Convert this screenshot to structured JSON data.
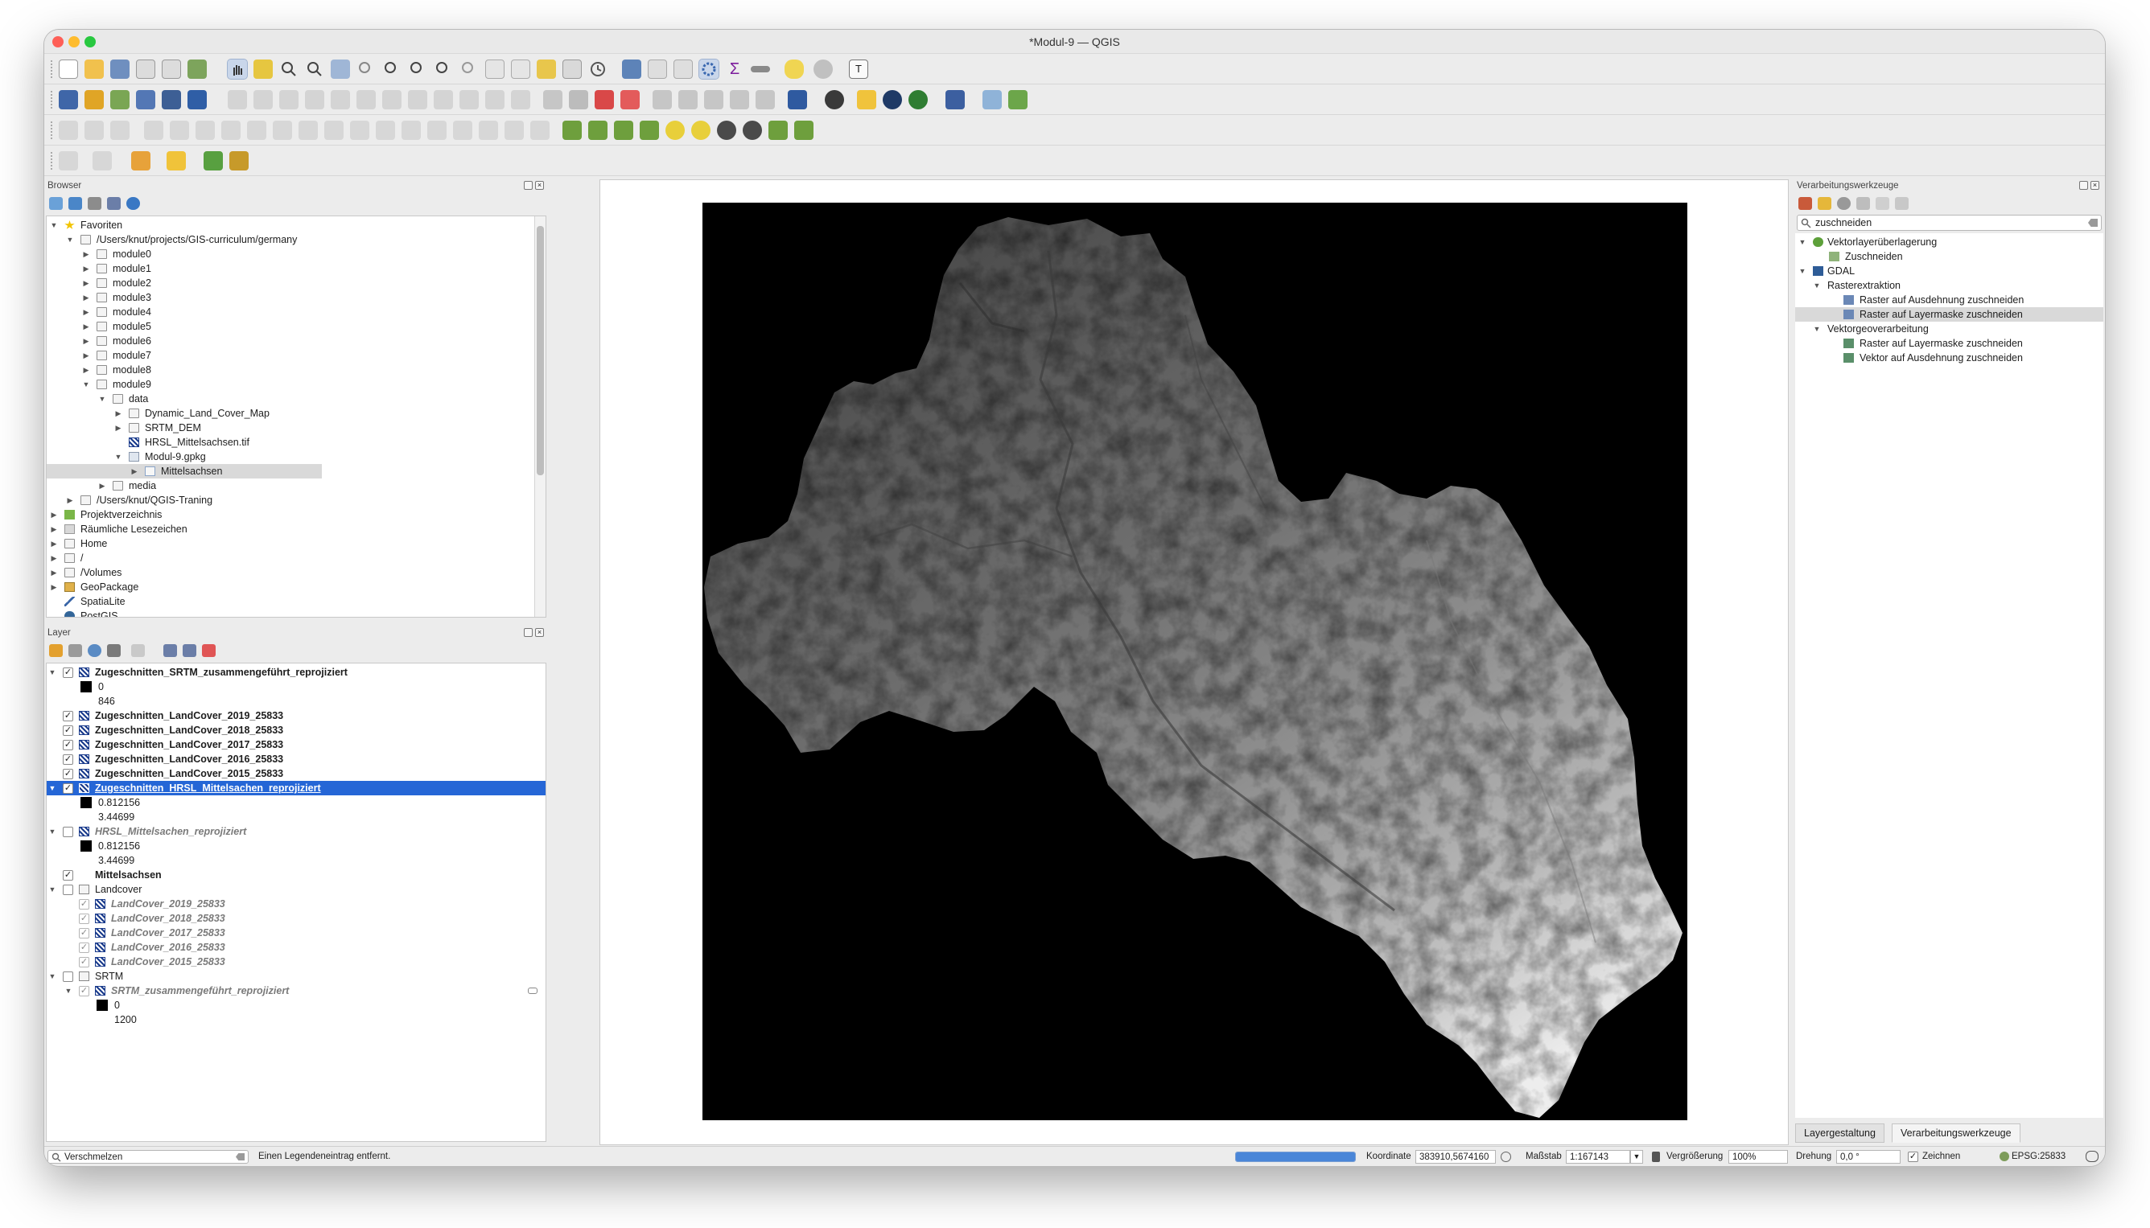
{
  "window": {
    "title": "*Modul-9 — QGIS"
  },
  "browser": {
    "title": "Browser",
    "items": [
      {
        "label": "Favoriten"
      },
      {
        "label": "/Users/knut/projects/GIS-curriculum/germany"
      },
      {
        "label": "module0"
      },
      {
        "label": "module1"
      },
      {
        "label": "module2"
      },
      {
        "label": "module3"
      },
      {
        "label": "module4"
      },
      {
        "label": "module5"
      },
      {
        "label": "module6"
      },
      {
        "label": "module7"
      },
      {
        "label": "module8"
      },
      {
        "label": "module9"
      },
      {
        "label": "data"
      },
      {
        "label": "Dynamic_Land_Cover_Map"
      },
      {
        "label": "SRTM_DEM"
      },
      {
        "label": "HRSL_Mittelsachsen.tif"
      },
      {
        "label": "Modul-9.gpkg"
      },
      {
        "label": "Mittelsachsen"
      },
      {
        "label": "media"
      },
      {
        "label": "/Users/knut/QGIS-Traning"
      },
      {
        "label": "Projektverzeichnis"
      },
      {
        "label": "Räumliche Lesezeichen"
      },
      {
        "label": "Home"
      },
      {
        "label": "/"
      },
      {
        "label": "/Volumes"
      },
      {
        "label": "GeoPackage"
      },
      {
        "label": "SpatiaLite"
      },
      {
        "label": "PostGIS"
      }
    ]
  },
  "layers": {
    "title": "Layer",
    "items": [
      {
        "label": "Zugeschnitten_SRTM_zusammengeführt_reprojiziert"
      },
      {
        "label": "0"
      },
      {
        "label": "846"
      },
      {
        "label": "Zugeschnitten_LandCover_2019_25833"
      },
      {
        "label": "Zugeschnitten_LandCover_2018_25833"
      },
      {
        "label": "Zugeschnitten_LandCover_2017_25833"
      },
      {
        "label": "Zugeschnitten_LandCover_2016_25833"
      },
      {
        "label": "Zugeschnitten_LandCover_2015_25833"
      },
      {
        "label": "Zugeschnitten_HRSL_Mittelsachen_reprojiziert"
      },
      {
        "label": "0.812156"
      },
      {
        "label": "3.44699"
      },
      {
        "label": "HRSL_Mittelsachen_reprojiziert"
      },
      {
        "label": "0.812156"
      },
      {
        "label": "3.44699"
      },
      {
        "label": "Mittelsachsen"
      },
      {
        "label": "Landcover"
      },
      {
        "label": "LandCover_2019_25833"
      },
      {
        "label": "LandCover_2018_25833"
      },
      {
        "label": "LandCover_2017_25833"
      },
      {
        "label": "LandCover_2016_25833"
      },
      {
        "label": "LandCover_2015_25833"
      },
      {
        "label": "SRTM"
      },
      {
        "label": "SRTM_zusammengeführt_reprojiziert"
      },
      {
        "label": "0"
      },
      {
        "label": "1200"
      }
    ]
  },
  "processing": {
    "title": "Verarbeitungswerkzeuge",
    "search_value": "zuschneiden",
    "items": [
      {
        "label": "Vektorlayerüberlagerung"
      },
      {
        "label": "Zuschneiden"
      },
      {
        "label": "GDAL"
      },
      {
        "label": "Rasterextraktion"
      },
      {
        "label": "Raster auf Ausdehnung zuschneiden"
      },
      {
        "label": "Raster auf Layermaske zuschneiden"
      },
      {
        "label": "Vektorgeoverarbeitung"
      },
      {
        "label": "Raster auf Layermaske zuschneiden"
      },
      {
        "label": "Vektor auf Ausdehnung zuschneiden"
      }
    ],
    "tabs": [
      "Layergestaltung",
      "Verarbeitungswerkzeuge"
    ]
  },
  "status": {
    "locator_value": "Verschmelzen",
    "message": "Einen Legendeneintrag entfernt.",
    "coord_label": "Koordinate",
    "coord_value": "383910,5674160",
    "scale_label": "Maßstab",
    "scale_value": "1:167143",
    "zoom_label": "Vergrößerung",
    "zoom_value": "100%",
    "rotation_label": "Drehung",
    "rotation_value": "0,0 °",
    "render_label": "Zeichnen",
    "crs_value": "EPSG:25833",
    "progress_fraction": 1.0
  },
  "colors": {
    "selection": "#2566d6",
    "accent": "#1a3b8c"
  }
}
